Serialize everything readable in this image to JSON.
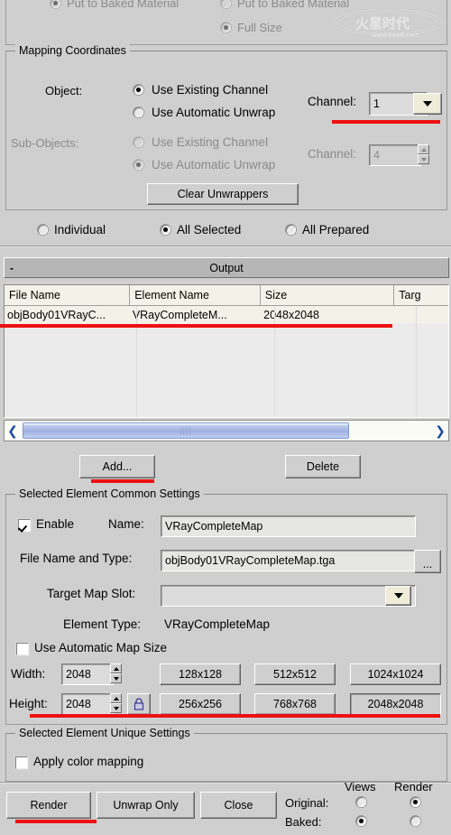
{
  "top_partial": {
    "left_option": "Put to Baked Material",
    "right_option": "Put to Baked Material",
    "full_size": "Full Size"
  },
  "mapping_coordinates": {
    "title": "Mapping Coordinates",
    "object_label": "Object:",
    "object_options": [
      "Use Existing Channel",
      "Use Automatic Unwrap"
    ],
    "object_selected": 0,
    "subobjects_label": "Sub-Objects:",
    "subobject_options": [
      "Use Existing Channel",
      "Use Automatic Unwrap"
    ],
    "subobject_selected": 1,
    "channel_label": "Channel:",
    "channel_value": "1",
    "sub_channel_label": "Channel:",
    "sub_channel_value": "4",
    "clear_unwrappers": "Clear Unwrappers"
  },
  "scope": {
    "options": [
      "Individual",
      "All Selected",
      "All Prepared"
    ],
    "selected": 1
  },
  "output": {
    "rollout_title": "Output",
    "collapse_glyph": "-",
    "columns": [
      "File Name",
      "Element Name",
      "Size",
      "Targ"
    ],
    "rows": [
      {
        "file_name": "objBody01VRayC...",
        "element_name": "VRayCompleteM...",
        "size": "2048x2048",
        "target": ""
      }
    ],
    "scroll_left_glyph": "❮",
    "scroll_right_glyph": "❯",
    "add_button": "Add...",
    "delete_button": "Delete"
  },
  "common_settings": {
    "title": "Selected Element Common Settings",
    "enable_label": "Enable",
    "enable_checked": true,
    "name_label": "Name:",
    "name_value": "VRayCompleteMap",
    "file_name_label": "File Name and Type:",
    "file_name_value": "objBody01VRayCompleteMap.tga",
    "browse_button": "...",
    "target_map_slot_label": "Target Map Slot:",
    "target_map_slot_value": "",
    "element_type_label": "Element Type:",
    "element_type_value": "VRayCompleteMap",
    "use_auto_map_size_label": "Use Automatic Map Size",
    "use_auto_map_size_checked": false,
    "width_label": "Width:",
    "width_value": "2048",
    "height_label": "Height:",
    "height_value": "2048",
    "lock_icon": "padlock-icon",
    "size_presets": [
      "128x128",
      "512x512",
      "1024x1024",
      "256x256",
      "768x768",
      "2048x2048"
    ],
    "size_preset_active": "2048x2048"
  },
  "unique_settings": {
    "title": "Selected Element Unique Settings",
    "apply_color_mapping_label": "Apply color mapping",
    "apply_color_mapping_checked": false
  },
  "footer": {
    "render_button": "Render",
    "unwrap_only_button": "Unwrap Only",
    "close_button": "Close",
    "col_views": "Views",
    "col_render": "Render",
    "row_original": "Original:",
    "row_baked": "Baked:",
    "original_views_selected": false,
    "original_render_selected": true,
    "baked_views_selected": true,
    "baked_render_selected": false
  },
  "watermark": {
    "text": "火星时代",
    "sub": "www.hxsd.com"
  },
  "colors": {
    "background": "#cfcfcf",
    "highlight_red": "#ee1111",
    "field": "#e6e6e2",
    "rollout": "#b6b6b6"
  }
}
